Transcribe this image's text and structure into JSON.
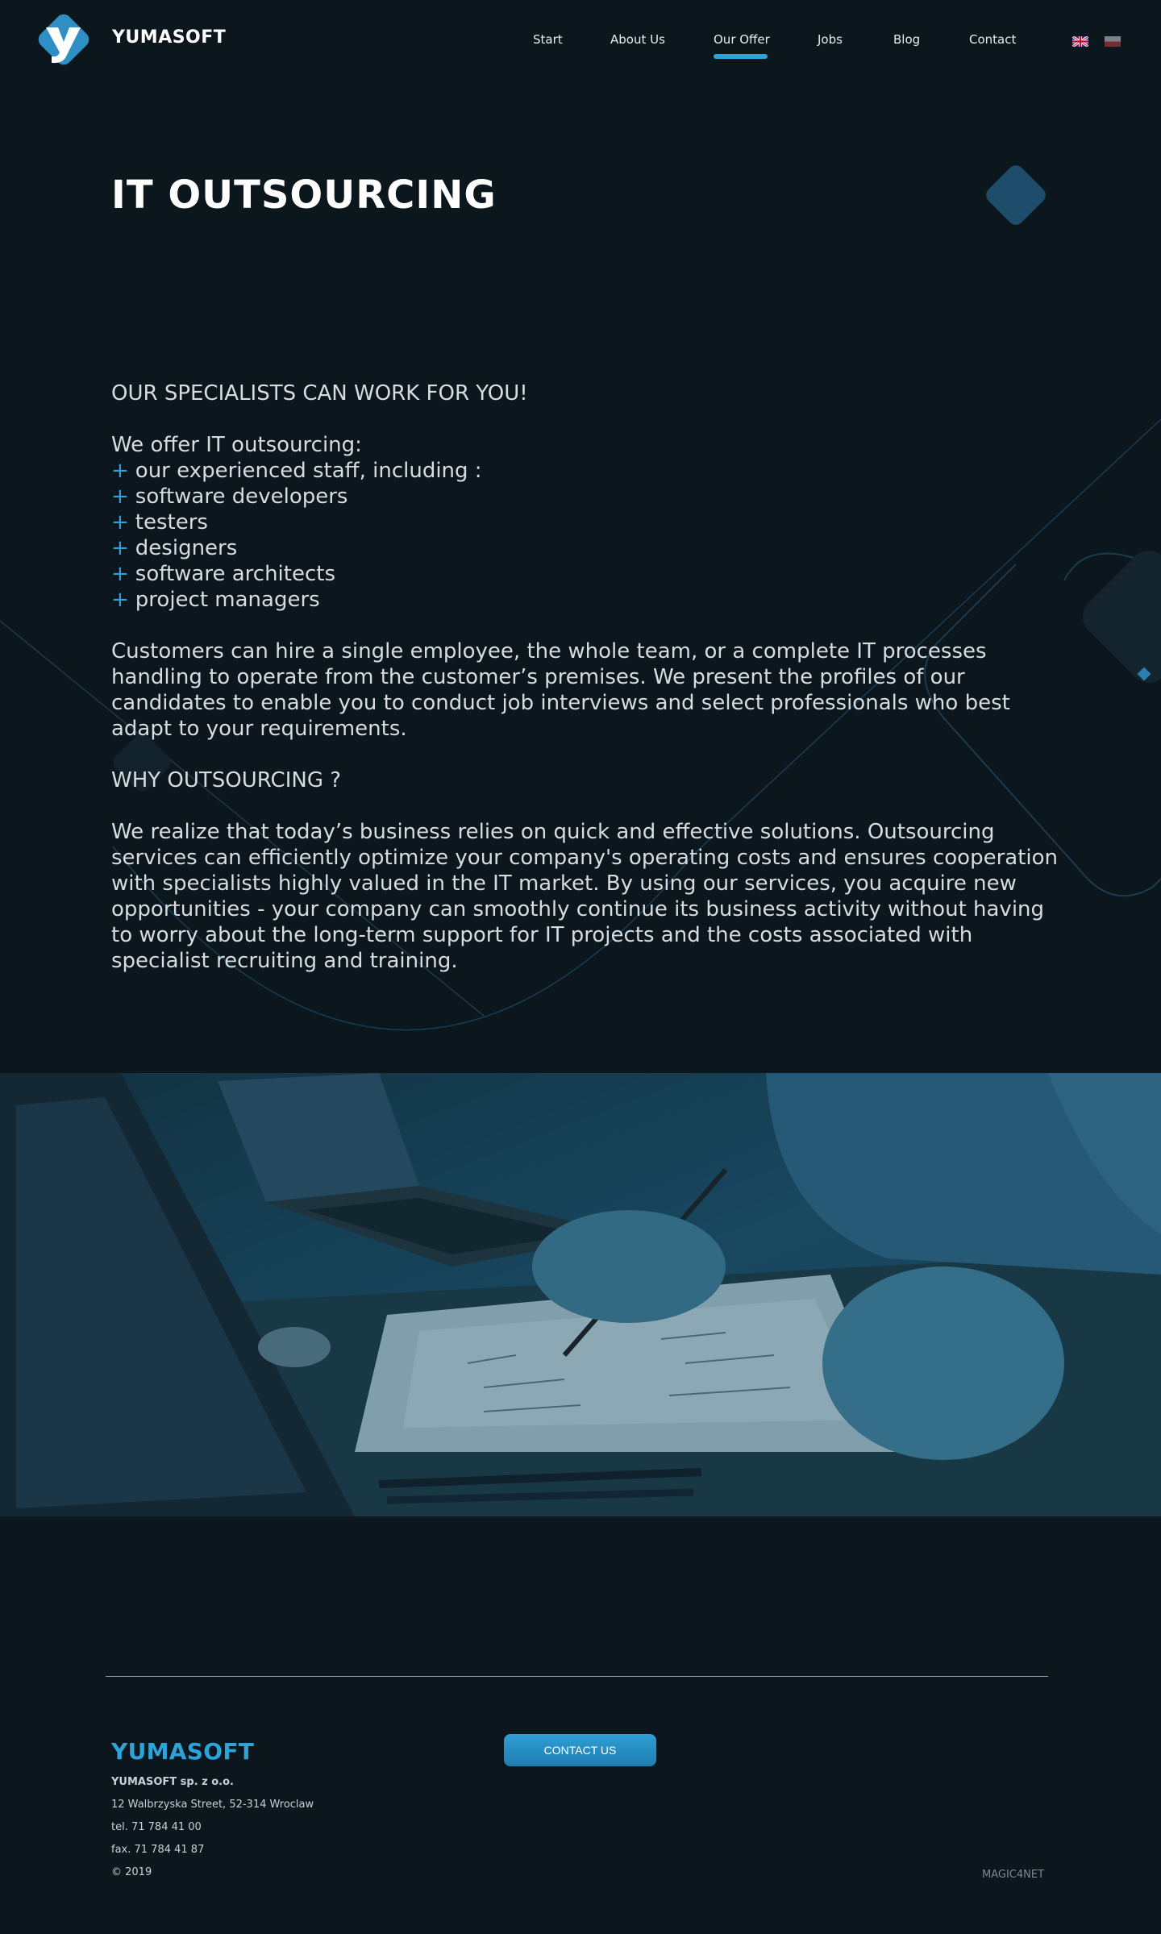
{
  "header": {
    "brand": "YUMASOFT",
    "nav": [
      "Start",
      "About Us",
      "Our Offer",
      "Jobs",
      "Blog",
      "Contact"
    ],
    "active_nav": "Our Offer",
    "languages": [
      "English",
      "Polish"
    ]
  },
  "hero": {
    "title": "IT OUTSOURCING"
  },
  "content": {
    "heading1": "OUR SPECIALISTS CAN WORK FOR YOU!",
    "intro": "We offer IT outsourcing:",
    "list_marker": "+",
    "list": [
      "our experienced staff, including :",
      "software developers",
      "testers",
      "designers",
      "software architects",
      "project managers"
    ],
    "para1_lines": [
      "Customers can hire a single employee, the whole team, or a complete IT processes",
      "handling to operate from the customer’s premises. We present the profiles of our",
      "candidates to enable you to conduct job interviews and select professionals who best",
      "adapt to your requirements."
    ],
    "heading2": "WHY OUTSOURCING ?",
    "para2_lines": [
      "We realize that today’s business relies on quick and effective solutions. Outsourcing",
      "services can efficiently optimize your company's operating costs and ensures cooperation",
      "with specialists highly valued in the IT market. By using our services, you acquire new",
      "opportunities - your company can smoothly continue its business activity without having",
      "to worry about the long-term support for IT projects and the costs associated with",
      "specialist recruiting and training."
    ]
  },
  "footer": {
    "brand": "YUMASOFT",
    "company": "YUMASOFT sp. z o.o.",
    "address": "12 Walbrzyska Street, 52-314 Wroclaw",
    "tel": "tel. 71 784 41 00",
    "fax": "fax. 71 784 41 87",
    "copyright": "© 2019",
    "contact_button": "CONTACT US",
    "credit": "MAGIC4NET"
  },
  "colors": {
    "background": "#0c161d",
    "accent": "#2ea3d8",
    "text": "#d5dce2"
  }
}
